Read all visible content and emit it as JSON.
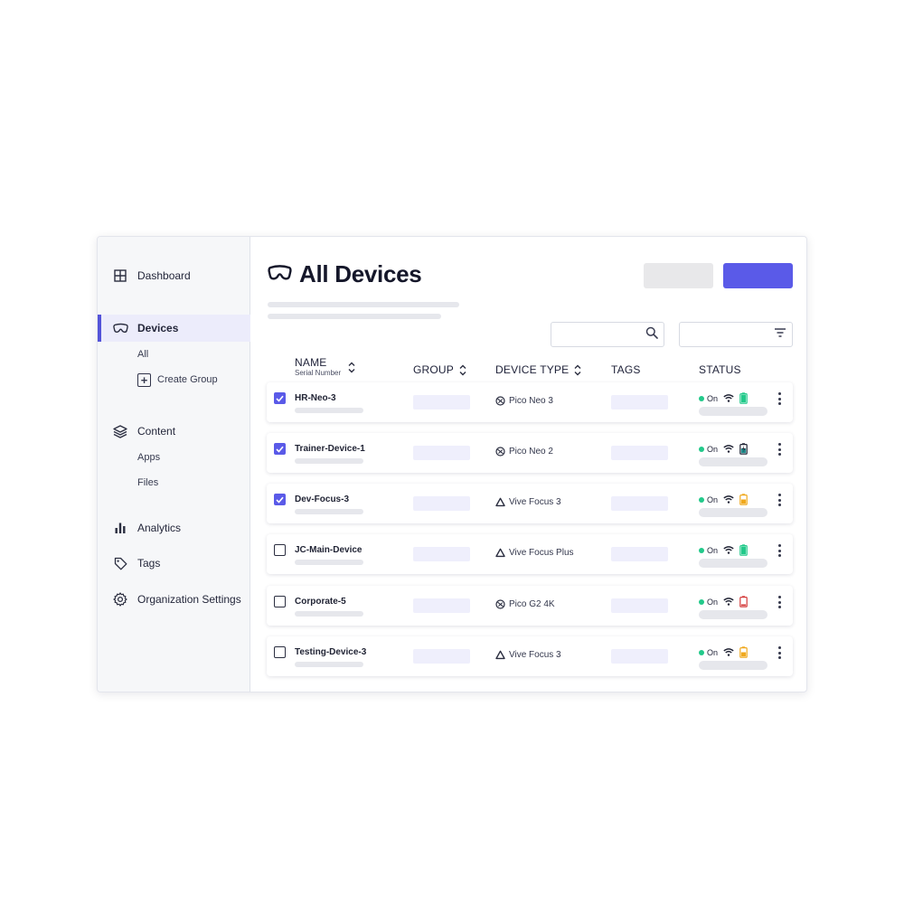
{
  "sidebar": {
    "items": [
      {
        "label": "Dashboard",
        "icon": "grid-icon"
      },
      {
        "label": "Devices",
        "icon": "vr-headset-icon",
        "active": true
      },
      {
        "label": "Content",
        "icon": "layers-icon"
      },
      {
        "label": "Analytics",
        "icon": "bar-chart-icon"
      },
      {
        "label": "Tags",
        "icon": "tag-icon"
      },
      {
        "label": "Organization Settings",
        "icon": "gear-icon"
      }
    ],
    "devices_sub": {
      "all": "All",
      "create_group": "Create Group"
    },
    "content_sub": {
      "apps": "Apps",
      "files": "Files"
    }
  },
  "header": {
    "title": "All Devices",
    "icon": "vr-headset-icon"
  },
  "search": {
    "placeholder": ""
  },
  "colors": {
    "accent": "#5a5ae8",
    "online": "#22c98a",
    "battery_full": "#22c98a",
    "battery_charging": "#1e8a8a",
    "battery_medium": "#f0a81c",
    "battery_low": "#d43a3a"
  },
  "table": {
    "headers": {
      "name": "NAME",
      "name_sub": "Serial Number",
      "group": "GROUP",
      "device_type": "DEVICE TYPE",
      "tags": "TAGS",
      "status": "STATUS"
    },
    "rows": [
      {
        "name": "HR-Neo-3",
        "checked": true,
        "device_type": "Pico Neo 3",
        "device_icon": "pico-icon",
        "status": "On",
        "battery": "full"
      },
      {
        "name": "Trainer-Device-1",
        "checked": true,
        "device_type": "Pico Neo 2",
        "device_icon": "pico-icon",
        "status": "On",
        "battery": "charging"
      },
      {
        "name": "Dev-Focus-3",
        "checked": true,
        "device_type": "Vive Focus 3",
        "device_icon": "vive-icon",
        "status": "On",
        "battery": "medium"
      },
      {
        "name": "JC-Main-Device",
        "checked": false,
        "device_type": "Vive Focus Plus",
        "device_icon": "vive-icon",
        "status": "On",
        "battery": "full"
      },
      {
        "name": "Corporate-5",
        "checked": false,
        "device_type": "Pico G2 4K",
        "device_icon": "pico-icon",
        "status": "On",
        "battery": "low"
      },
      {
        "name": "Testing-Device-3",
        "checked": false,
        "device_type": "Vive Focus 3",
        "device_icon": "vive-icon",
        "status": "On",
        "battery": "medium"
      }
    ]
  }
}
